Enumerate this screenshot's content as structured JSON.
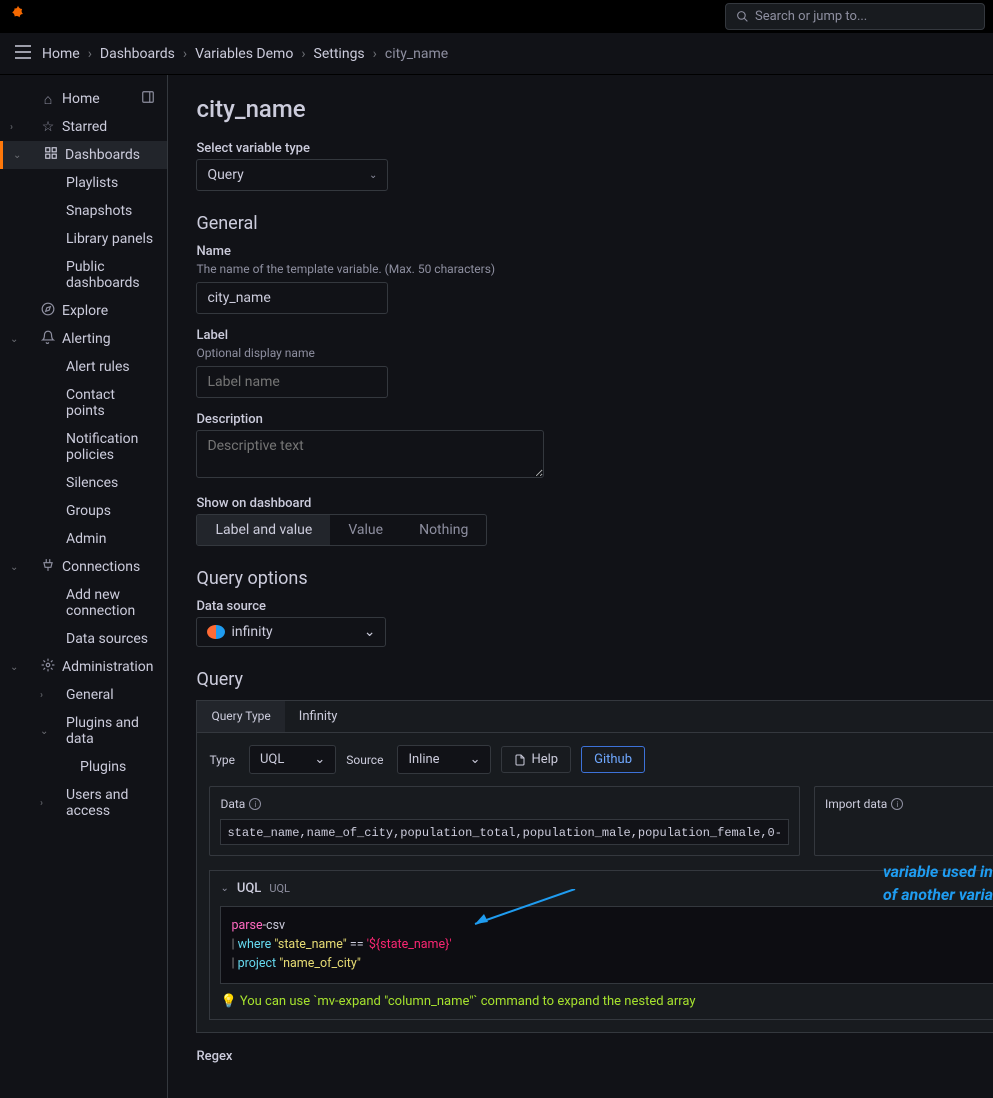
{
  "header": {
    "search_placeholder": "Search or jump to..."
  },
  "breadcrumb": {
    "items": [
      "Home",
      "Dashboards",
      "Variables Demo",
      "Settings"
    ],
    "current": "city_name"
  },
  "sidebar": {
    "home": "Home",
    "starred": "Starred",
    "dashboards": "Dashboards",
    "dash_children": [
      "Playlists",
      "Snapshots",
      "Library panels",
      "Public dashboards"
    ],
    "explore": "Explore",
    "alerting": "Alerting",
    "alert_children": [
      "Alert rules",
      "Contact points",
      "Notification policies",
      "Silences",
      "Groups",
      "Admin"
    ],
    "connections": "Connections",
    "conn_children": [
      "Add new connection",
      "Data sources"
    ],
    "administration": "Administration",
    "admin_children": [
      "General",
      "Plugins and data",
      "Plugins",
      "Users and access"
    ]
  },
  "page": {
    "title": "city_name",
    "var_type_label": "Select variable type",
    "var_type_value": "Query",
    "general_heading": "General",
    "name_label": "Name",
    "name_hint": "The name of the template variable. (Max. 50 characters)",
    "name_value": "city_name",
    "label_label": "Label",
    "label_hint": "Optional display name",
    "label_placeholder": "Label name",
    "desc_label": "Description",
    "desc_placeholder": "Descriptive text",
    "show_label": "Show on dashboard",
    "show_options": [
      "Label and value",
      "Value",
      "Nothing"
    ],
    "qopts_heading": "Query options",
    "ds_label": "Data source",
    "ds_value": "infinity",
    "query_heading": "Query",
    "query_type_label": "Query Type",
    "query_type_value": "Infinity",
    "type_label": "Type",
    "type_value": "UQL",
    "source_label": "Source",
    "source_value": "Inline",
    "help_btn": "Help",
    "github_btn": "Github",
    "data_label": "Data",
    "import_label": "Import data",
    "data_value": "state_name,name_of_city,population_total,population_male,population_female,0-",
    "uql_label": "UQL",
    "uql_sub": "UQL",
    "code_line1_kw": "parse",
    "code_line1_rest": "-csv",
    "code_line2_kw": "where",
    "code_line2_str": "\"state_name\"",
    "code_line2_eq": " == ",
    "code_line2_var": "'${state_name}'",
    "code_line3_kw": "project",
    "code_line3_str": "\"name_of_city\"",
    "tip_text": "You can use `mv-expand \"column_name\"` command to expand the nested array",
    "regex_label": "Regex"
  },
  "annotation": {
    "line1": "variable used in query",
    "line2": "of another variable"
  }
}
